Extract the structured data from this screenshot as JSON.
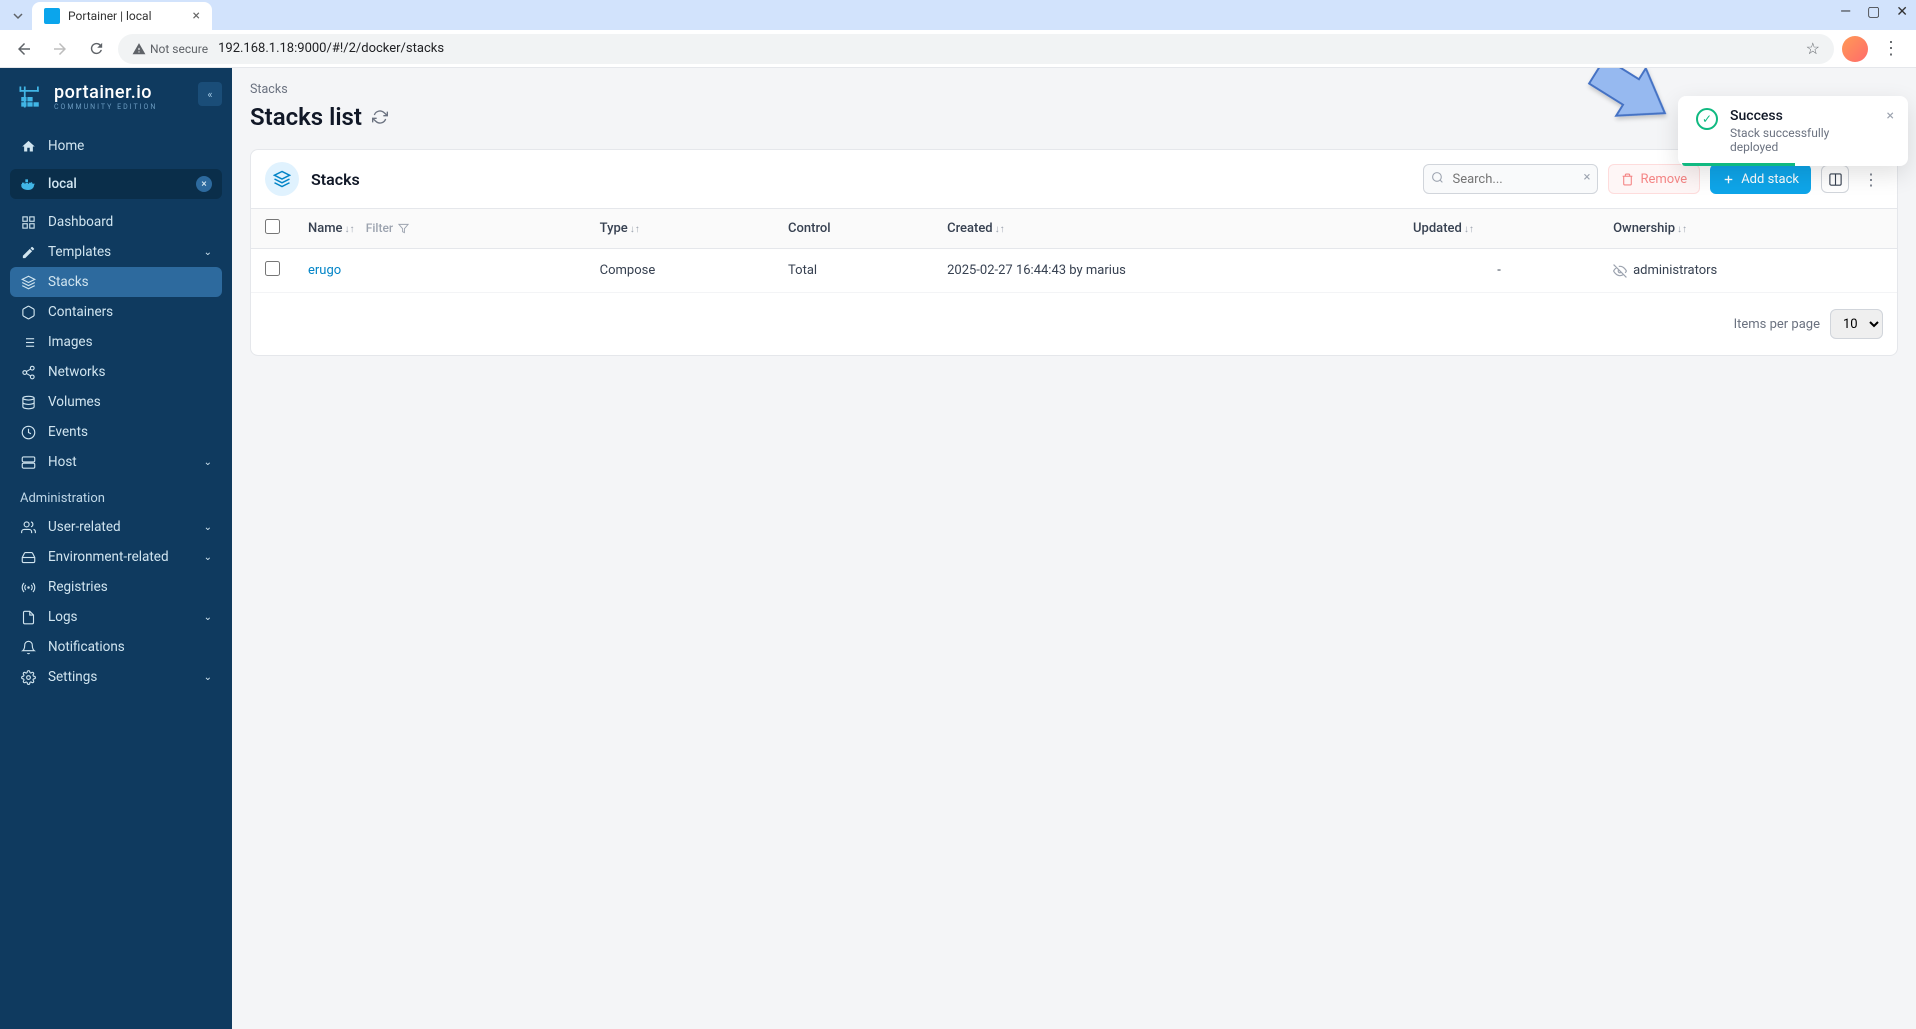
{
  "browser": {
    "tab_title": "Portainer | local",
    "url_security": "Not secure",
    "url": "192.168.1.18:9000/#!/2/docker/stacks"
  },
  "sidebar": {
    "brand": "portainer.io",
    "edition": "COMMUNITY EDITION",
    "home": "Home",
    "env_name": "local",
    "items": [
      "Dashboard",
      "Templates",
      "Stacks",
      "Containers",
      "Images",
      "Networks",
      "Volumes",
      "Events",
      "Host"
    ],
    "admin_label": "Administration",
    "admin_items": [
      "User-related",
      "Environment-related",
      "Registries",
      "Logs",
      "Notifications",
      "Settings"
    ]
  },
  "page": {
    "breadcrumb": "Stacks",
    "title": "Stacks list",
    "card_title": "Stacks",
    "search_placeholder": "Search...",
    "remove_btn": "Remove",
    "add_btn": "Add stack",
    "columns": {
      "name": "Name",
      "filter": "Filter",
      "type": "Type",
      "control": "Control",
      "created": "Created",
      "updated": "Updated",
      "ownership": "Ownership"
    },
    "rows": [
      {
        "name": "erugo",
        "type": "Compose",
        "control": "Total",
        "created": "2025-02-27 16:44:43 by marius",
        "updated": "-",
        "ownership": "administrators"
      }
    ],
    "footer_label": "Items per page",
    "page_size": "10"
  },
  "toast": {
    "title": "Success",
    "message": "Stack successfully deployed"
  }
}
